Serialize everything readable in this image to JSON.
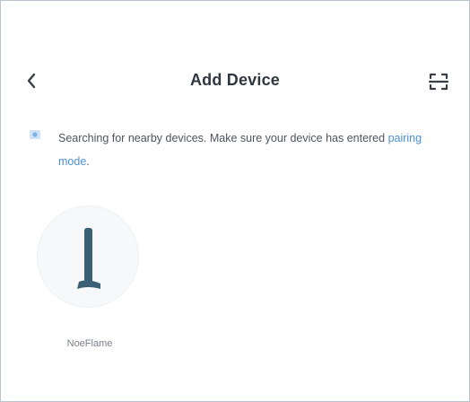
{
  "header": {
    "title": "Add Device"
  },
  "notice": {
    "text": "Searching for nearby devices. Make sure your device has entered ",
    "link": "pairing mode",
    "end": "."
  },
  "devices": [
    {
      "name": "NoeFlame"
    }
  ],
  "colors": {
    "accent": "#4a8fd9",
    "device_glyph": "#3b5f74"
  }
}
